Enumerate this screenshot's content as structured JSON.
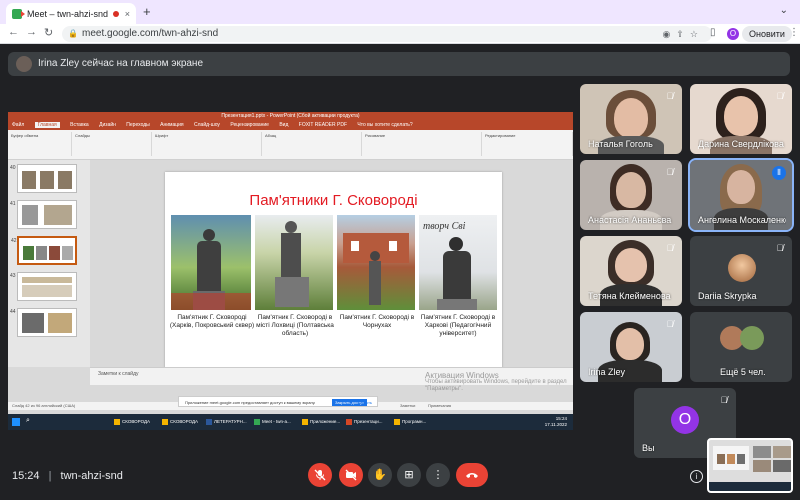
{
  "browser": {
    "tab_title": "Meet – twn-ahzi-snd",
    "tab_close": "×",
    "new_tab": "+",
    "url": "meet.google.com/twn-ahzi-snd",
    "profile_initial": "O",
    "update_button": "Оновити"
  },
  "banner": {
    "text": "Irina Zley сейчас на главном экране"
  },
  "powerpoint": {
    "window_title": "Презентация1.pptx - PowerPoint (Сбой активации продукта)",
    "menu": [
      "Файл",
      "Главная",
      "Вставка",
      "Дизайн",
      "Переходы",
      "Анимация",
      "Слайд-шоу",
      "Рецензирование",
      "Вид",
      "FOXIT READER PDF",
      "Что вы хотите сделать?"
    ],
    "ribbon_groups": [
      "Буфер обмена",
      "Слайды",
      "Шрифт",
      "Абзац",
      "Рисование",
      "Редактирование"
    ],
    "thumb_numbers": [
      "40",
      "41",
      "42",
      "43",
      "44"
    ],
    "slide": {
      "title": "Пам'ятники Г. Сковороді",
      "captions": [
        "Пам'ятник Г. Сковороді (Харків, Покровський сквер)",
        "Пам'ятник Г. Сковороді в місті Лохвиці (Полтавська область)",
        "Пам'ятник Г. Сковороді в Чорнухах",
        "Пам'ятник Г. Сковороді в Харкові (Педагогічний університет)"
      ]
    },
    "notes_placeholder": "Заметки к слайду",
    "status_text": "Слайд 42 из 96   английский (США)",
    "notes_button": "Заметки",
    "comments_button": "Примечания",
    "activation": {
      "title": "Активация Windows",
      "text": "Чтобы активировать Windows, перейдите в раздел \"Параметры\"."
    },
    "share_bar": {
      "text": "Приложение meet.google.com предоставляет доступ к вашему экрану.",
      "stop": "Закрыть доступ",
      "hide": "Скрыть"
    },
    "taskbar_items": [
      "СКОВОРОДА",
      "СКОВОРОДА",
      "ЛЕТЕРАТУРН...",
      "Meet - twn-a...",
      "Приложение...",
      "Презентаци...",
      "Програмн..."
    ],
    "clock_time": "15:24",
    "clock_date": "17.11.2022"
  },
  "participants": [
    {
      "name": "Наталья Гоголь",
      "muted": true
    },
    {
      "name": "Дарина Свердлікова",
      "muted": true
    },
    {
      "name": "Анастасія Ананьєва",
      "muted": true
    },
    {
      "name": "Ангелина Москаленко",
      "muted": false
    },
    {
      "name": "Тетяна Клейменова",
      "muted": true
    },
    {
      "name": "Dariia Skrypka",
      "muted": true
    },
    {
      "name": "Irina Zley",
      "muted": true
    },
    {
      "name": "Ещё 5 чел.",
      "muted": false
    },
    {
      "name": "Вы",
      "muted": true,
      "initial": "O"
    }
  ],
  "bottom_bar": {
    "time": "15:24",
    "separator": "|",
    "meeting_code": "twn-ahzi-snd"
  },
  "colors": {
    "meet_background": "#202124",
    "tile_background": "#3c4043",
    "danger_red": "#ea4335",
    "accent_blue": "#1a73e8",
    "ppt_orange": "#b7472a",
    "slide_title_red": "#e31b23",
    "avatar_purple": "#9334e6"
  }
}
